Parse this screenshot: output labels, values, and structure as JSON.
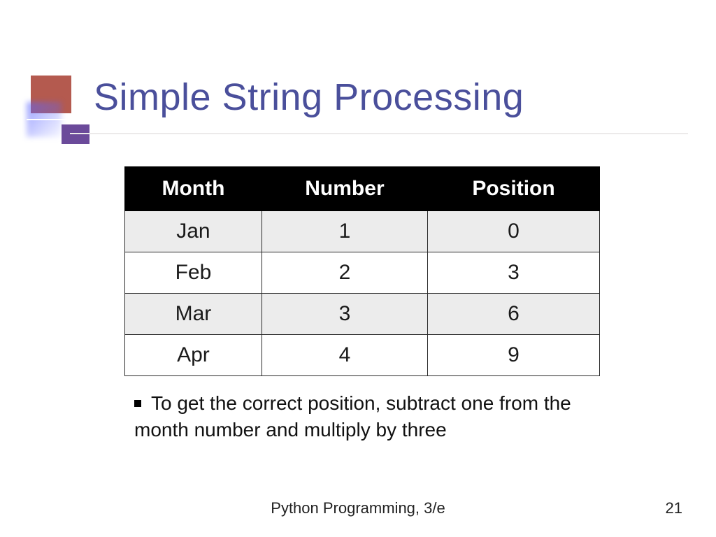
{
  "title": "Simple String Processing",
  "chart_data": {
    "type": "table",
    "columns": [
      "Month",
      "Number",
      "Position"
    ],
    "rows": [
      [
        "Jan",
        "1",
        "0"
      ],
      [
        "Feb",
        "2",
        "3"
      ],
      [
        "Mar",
        "3",
        "6"
      ],
      [
        "Apr",
        "4",
        "9"
      ]
    ]
  },
  "bullet": "To get the correct position, subtract one from the month number and multiply by three",
  "footer": "Python Programming, 3/e",
  "page_number": "21"
}
